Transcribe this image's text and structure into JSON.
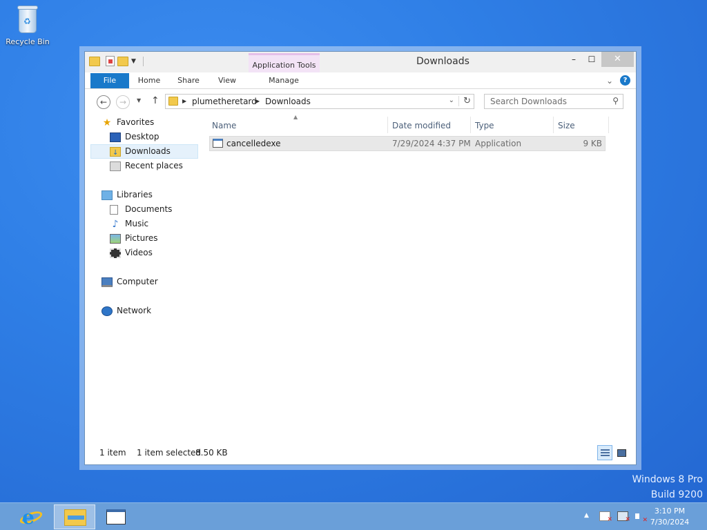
{
  "desktop": {
    "recycle_bin_label": "Recycle Bin",
    "watermark_line1": "Windows 8 Pro",
    "watermark_line2": "Build 9200"
  },
  "window": {
    "title": "Downloads",
    "context_tab": "Application Tools",
    "ribbon_tabs": {
      "file": "File",
      "home": "Home",
      "share": "Share",
      "view": "View",
      "manage": "Manage"
    },
    "address": {
      "crumbs": [
        "plumetheretard",
        "Downloads"
      ]
    },
    "search": {
      "placeholder": "Search Downloads"
    },
    "nav_pane": {
      "favorites": "Favorites",
      "desktop": "Desktop",
      "downloads": "Downloads",
      "recent_places": "Recent places",
      "libraries": "Libraries",
      "documents": "Documents",
      "music": "Music",
      "pictures": "Pictures",
      "videos": "Videos",
      "computer": "Computer",
      "network": "Network"
    },
    "columns": {
      "name": "Name",
      "date_modified": "Date modified",
      "type": "Type",
      "size": "Size"
    },
    "files": [
      {
        "name": "cancelledexe",
        "date_modified": "7/29/2024 4:37 PM",
        "type": "Application",
        "size": "9 KB"
      }
    ],
    "status": {
      "item_count": "1 item",
      "selection": "1 item selected",
      "selection_size": "8.50 KB"
    }
  },
  "taskbar": {
    "time": "3:10 PM",
    "date": "7/30/2024"
  },
  "colors": {
    "accent": "#1979ca",
    "context_tab": "#f3e3f6",
    "desktop": "#2f7fe6"
  }
}
